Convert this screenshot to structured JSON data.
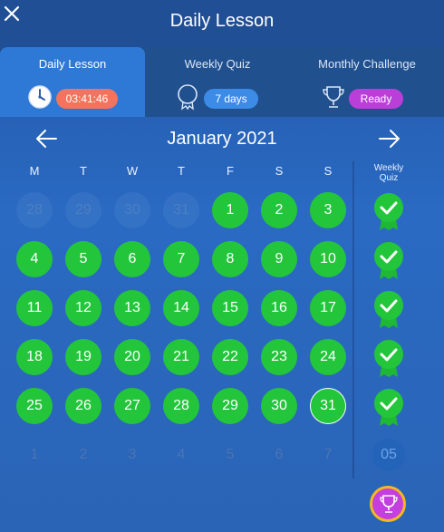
{
  "header": {
    "title": "Daily Lesson",
    "close_icon": "close-icon"
  },
  "tabs": [
    {
      "label": "Daily Lesson",
      "badge": "03:41:46",
      "icon": "clock-icon",
      "badge_color": "#f4735c",
      "active": true
    },
    {
      "label": "Weekly Quiz",
      "badge": "7 days",
      "icon": "medal-icon",
      "badge_color": "#3c8be6",
      "active": false
    },
    {
      "label": "Monthly Challenge",
      "badge": "Ready",
      "icon": "trophy-icon",
      "badge_color": "#b93fd8",
      "active": false
    }
  ],
  "calendar": {
    "month_label": "January 2021",
    "prev_icon": "arrow-left-icon",
    "next_icon": "arrow-right-icon",
    "weekdays": [
      "M",
      "T",
      "W",
      "T",
      "F",
      "S",
      "S"
    ],
    "weekly_quiz_header": "Weekly\nQuiz",
    "weeks": [
      {
        "days": [
          {
            "n": "28",
            "state": "prev"
          },
          {
            "n": "29",
            "state": "prev"
          },
          {
            "n": "30",
            "state": "prev"
          },
          {
            "n": "31",
            "state": "prev"
          },
          {
            "n": "1",
            "state": "done"
          },
          {
            "n": "2",
            "state": "done"
          },
          {
            "n": "3",
            "state": "done"
          }
        ],
        "quiz": "done"
      },
      {
        "days": [
          {
            "n": "4",
            "state": "done"
          },
          {
            "n": "5",
            "state": "done"
          },
          {
            "n": "6",
            "state": "done"
          },
          {
            "n": "7",
            "state": "done"
          },
          {
            "n": "8",
            "state": "done"
          },
          {
            "n": "9",
            "state": "done"
          },
          {
            "n": "10",
            "state": "done"
          }
        ],
        "quiz": "done"
      },
      {
        "days": [
          {
            "n": "11",
            "state": "done"
          },
          {
            "n": "12",
            "state": "done"
          },
          {
            "n": "13",
            "state": "done"
          },
          {
            "n": "14",
            "state": "done"
          },
          {
            "n": "15",
            "state": "done"
          },
          {
            "n": "16",
            "state": "done"
          },
          {
            "n": "17",
            "state": "done"
          }
        ],
        "quiz": "done"
      },
      {
        "days": [
          {
            "n": "18",
            "state": "done"
          },
          {
            "n": "19",
            "state": "done"
          },
          {
            "n": "20",
            "state": "done"
          },
          {
            "n": "21",
            "state": "done"
          },
          {
            "n": "22",
            "state": "done"
          },
          {
            "n": "23",
            "state": "done"
          },
          {
            "n": "24",
            "state": "done"
          }
        ],
        "quiz": "done"
      },
      {
        "days": [
          {
            "n": "25",
            "state": "done"
          },
          {
            "n": "26",
            "state": "done"
          },
          {
            "n": "27",
            "state": "done"
          },
          {
            "n": "28",
            "state": "done"
          },
          {
            "n": "29",
            "state": "done"
          },
          {
            "n": "30",
            "state": "done"
          },
          {
            "n": "31",
            "state": "today"
          }
        ],
        "quiz": "done"
      },
      {
        "days": [
          {
            "n": "1",
            "state": "next"
          },
          {
            "n": "2",
            "state": "next"
          },
          {
            "n": "3",
            "state": "next"
          },
          {
            "n": "4",
            "state": "next"
          },
          {
            "n": "5",
            "state": "next"
          },
          {
            "n": "6",
            "state": "next"
          },
          {
            "n": "7",
            "state": "next"
          }
        ],
        "quiz": "05"
      }
    ],
    "monthly_trophy_icon": "trophy-icon"
  },
  "colors": {
    "done_green": "#23c63a",
    "trophy_purple": "#c53fe0",
    "trophy_ring": "#f5b81b"
  }
}
